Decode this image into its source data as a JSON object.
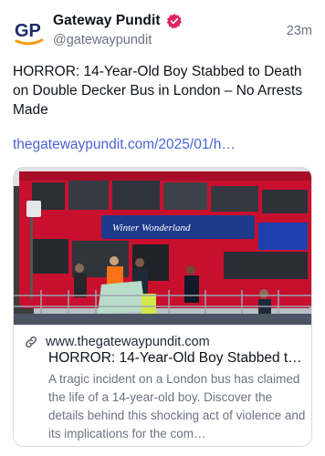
{
  "post": {
    "author": {
      "display_name": "Gateway Pundit",
      "handle": "@gatewaypundit",
      "avatar_text": "GP",
      "verified_icon": "verified-badge-icon",
      "avatar_colors": {
        "blue": "#1d2b6b",
        "orange": "#f39c12"
      }
    },
    "timestamp": "23m",
    "text": "HORROR: 14-Year-Old Boy Stabbed to Death on Double Decker Bus in London – No Arrests Made",
    "link": "thegatewaypundit.com/2025/01/h…",
    "card": {
      "domain": "www.thegatewaypundit.com",
      "title": "HORROR: 14-Year-Old Boy Stabbed t…",
      "description": "A tragic incident on a London bus has claimed the life of a 14-year-old boy. Discover the details behind this shocking act of violence and its implications for the com…",
      "image_icon": "bus-photo",
      "bus_banner_text": "Winter Wonderland"
    }
  },
  "colors": {
    "link": "#4a62d8",
    "verified": "#e0245e",
    "muted": "#6b7280",
    "bus_red": "#c8102e"
  }
}
